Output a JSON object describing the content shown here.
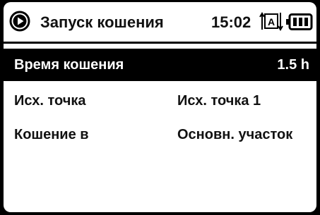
{
  "header": {
    "title": "Запуск кошения",
    "time": "15:02",
    "mode_icon": "auto-mode-icon",
    "battery_icon": "battery-full-icon",
    "play_icon": "play-circle-icon"
  },
  "rows": [
    {
      "label": "Время кошения",
      "value": "1.5 h",
      "selected": true
    },
    {
      "label": "Исх. точка",
      "value": "Исх. точка 1",
      "selected": false
    },
    {
      "label": "Кошение в",
      "value": "Основн. участок",
      "selected": false
    }
  ],
  "colors": {
    "background": "#000000",
    "screen": "#ffffff",
    "highlight": "#000000"
  }
}
